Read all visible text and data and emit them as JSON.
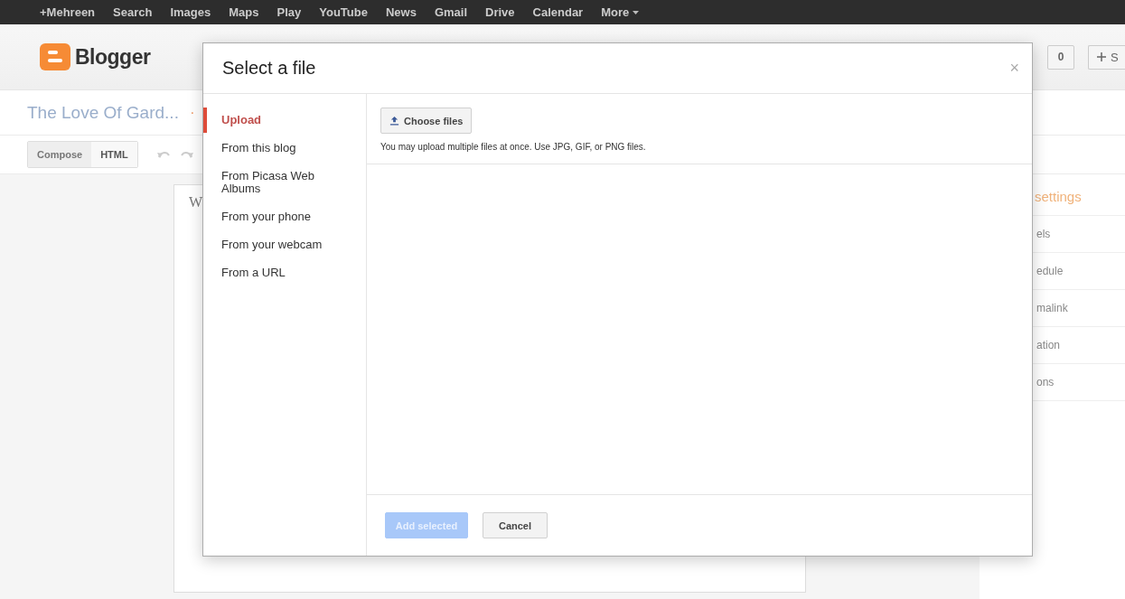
{
  "topbar": {
    "items": [
      "+Mehreen",
      "Search",
      "Images",
      "Maps",
      "Play",
      "YouTube",
      "News",
      "Gmail",
      "Drive",
      "Calendar",
      "More"
    ]
  },
  "header": {
    "logo": "Blogger",
    "counter": "0",
    "share_button": "S"
  },
  "post_bar": {
    "blog_title": "The Love Of Gard...",
    "separator": "·"
  },
  "toolbar": {
    "modes": [
      {
        "label": "Compose",
        "selected": true
      },
      {
        "label": "HTML",
        "selected": false
      }
    ]
  },
  "editor": {
    "text": "W"
  },
  "sidebar": {
    "heading": "settings",
    "items": [
      "els",
      "edule",
      "malink",
      "ation",
      "ons"
    ]
  },
  "dialog": {
    "title": "Select a file",
    "close": "×",
    "nav": [
      {
        "label": "Upload",
        "selected": true
      },
      {
        "label": "From this blog",
        "selected": false
      },
      {
        "label": "From Picasa Web Albums",
        "selected": false
      },
      {
        "label": "From your phone",
        "selected": false
      },
      {
        "label": "From your webcam",
        "selected": false
      },
      {
        "label": "From a URL",
        "selected": false
      }
    ],
    "choose_button": "Choose files",
    "hint": "You may upload multiple files at once. Use JPG, GIF, or PNG files.",
    "buttons": [
      {
        "label": "Add selected",
        "kind": "primary",
        "disabled": true
      },
      {
        "label": "Cancel",
        "kind": "secondary",
        "disabled": false
      }
    ]
  }
}
